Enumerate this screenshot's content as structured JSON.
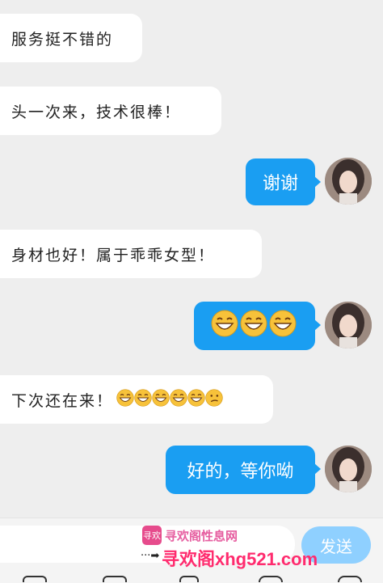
{
  "messages": [
    {
      "from": "other",
      "text": "服务挺不错的"
    },
    {
      "from": "other",
      "text": "头一次来，技术很棒！"
    },
    {
      "from": "me",
      "text": "谢谢"
    },
    {
      "from": "other",
      "text": "身材也好！属于乖乖女型！"
    },
    {
      "from": "me",
      "emojis": [
        "grin-emoji",
        "grin-emoji",
        "grin-emoji"
      ]
    },
    {
      "from": "other",
      "text": "下次还在来！",
      "emojis": [
        "grin-emoji",
        "grin-emoji",
        "grin-emoji",
        "grin-emoji",
        "grin-emoji",
        "thinking-emoji"
      ]
    },
    {
      "from": "me",
      "text": "好的，等你呦"
    }
  ],
  "input": {
    "placeholder": ""
  },
  "send_label": "发送",
  "watermark": {
    "logo_text": "寻欢",
    "small_text": "寻欢阁性息网",
    "arrow_text": "···➡",
    "big_text": "寻欢阁xhg521.com"
  },
  "colors": {
    "outgoing_bubble": "#1a9ef2",
    "send_button": "#8fd0ff",
    "watermark": "#ff2b6e"
  }
}
